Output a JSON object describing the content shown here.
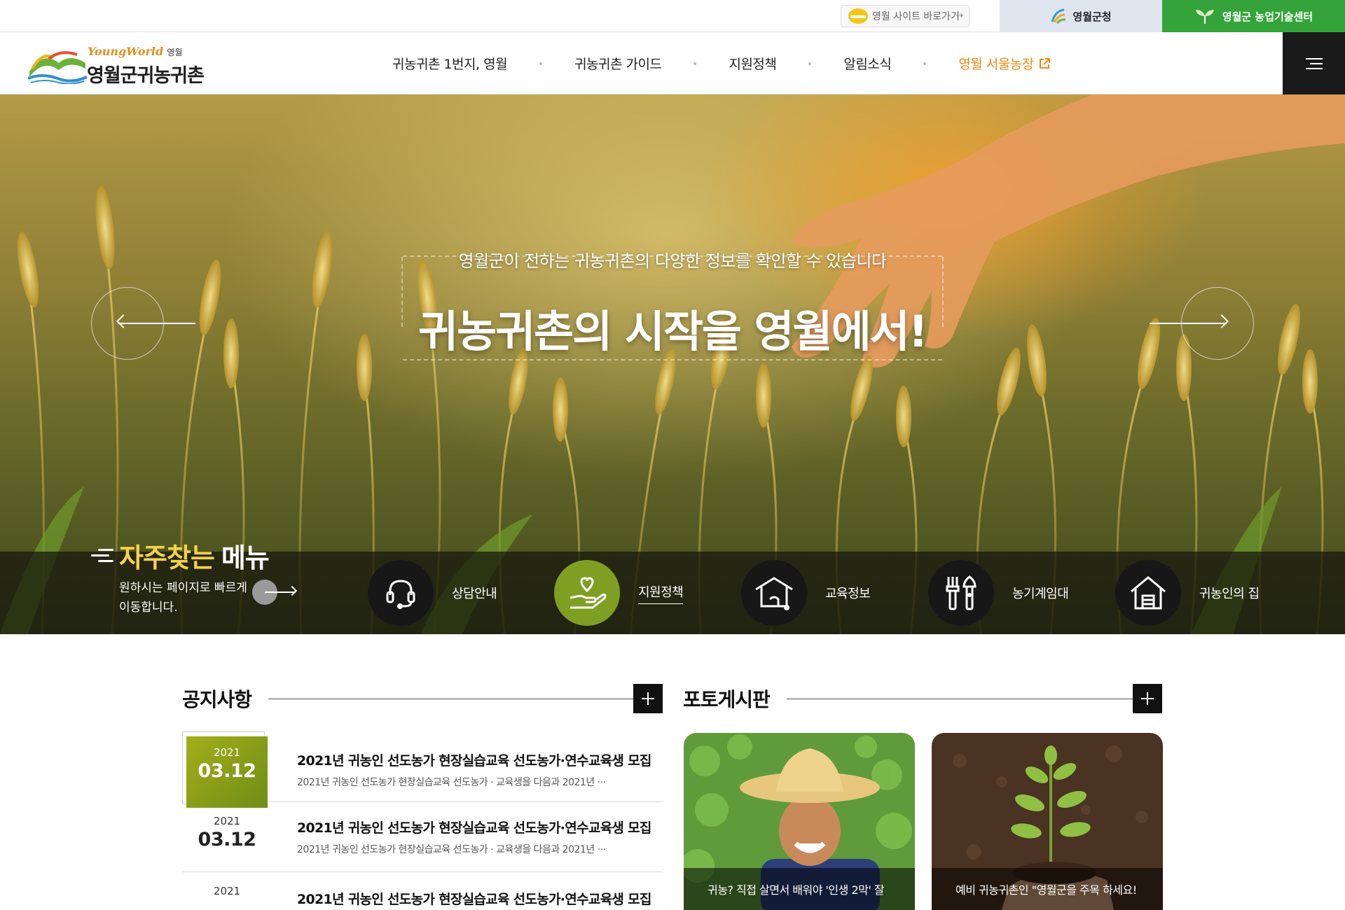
{
  "topbar": {
    "site_shortcut": "영월 사이트 바로가기",
    "county_office": "영월군청",
    "agri_center": "영월군 농업기술센터"
  },
  "logo": {
    "tag_en": "YoungWorld",
    "tag_ko": "영월",
    "name": "영월군귀농귀촌"
  },
  "gnb": [
    "귀농귀촌 1번지, 영월",
    "귀농귀촌 가이드",
    "지원정책",
    "알림소식",
    "영월 서울농장"
  ],
  "hero": {
    "subtitle": "영월군이 전하는 귀농귀촌의 다양한 정보를 확인할 수 있습니다",
    "title": "귀농귀촌의 시작을 영월에서!"
  },
  "quick_menu": {
    "title_highlight": "자주찾는",
    "title_rest": "메뉴",
    "desc_line1": "원하시는 페이지로 빠르게",
    "desc_line2": "이동합니다.",
    "items": [
      {
        "label": "상담안내",
        "icon": "headset-icon"
      },
      {
        "label": "지원정책",
        "icon": "hand-heart-icon"
      },
      {
        "label": "교육정보",
        "icon": "graduation-cap-icon"
      },
      {
        "label": "농기계임대",
        "icon": "farm-tools-icon"
      },
      {
        "label": "귀농인의 집",
        "icon": "house-icon"
      }
    ],
    "active_index": 1
  },
  "notice": {
    "heading": "공지사항",
    "items": [
      {
        "year": "2021",
        "date": "03.12",
        "title": "2021년 귀농인 선도농가 현장실습교육 선도농가·연수교육생 모집",
        "excerpt": "2021년 귀농인 선도농가 현장실습교육 선도농가 · 교육생을 다음과 2021년 ···"
      },
      {
        "year": "2021",
        "date": "03.12",
        "title": "2021년 귀농인 선도농가 현장실습교육 선도농가·연수교육생 모집",
        "excerpt": "2021년 귀농인 선도농가 현장실습교육 선도농가 · 교육생을 다음과 2021년 ···"
      },
      {
        "year": "2021",
        "date": "",
        "title": "2021년 귀농인 선도농가 현장실습교육 선도농가·연수교육생 모집",
        "excerpt": ""
      }
    ]
  },
  "photo_board": {
    "heading": "포토게시판",
    "items": [
      {
        "caption": "귀농? 직접 살면서 배워야 '인생 2막' 잘"
      },
      {
        "caption": "예비 귀농귀촌인 \"영월군을 주목 하세요!"
      }
    ]
  },
  "colors": {
    "accent_green": "#34a43a",
    "olive": "#7f9f23",
    "orange": "#f08a15"
  }
}
